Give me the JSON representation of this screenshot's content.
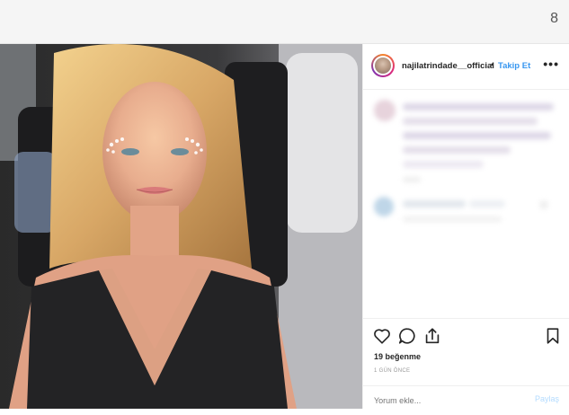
{
  "page": {
    "number": "8"
  },
  "post": {
    "username": "najilatrindade__official",
    "separator": "•",
    "follow_label": "Takip Et",
    "more_label": "•••",
    "likes": "19 beğenme",
    "time": "1 GÜN ÖNCE",
    "comment_placeholder": "Yorum ekle...",
    "post_label": "Paylaş"
  },
  "colors": {
    "accent": "#3897f0",
    "text": "#262626",
    "muted": "#999999",
    "disabled_accent": "#b3dbff"
  },
  "icons": [
    "heart-icon",
    "comment-icon",
    "share-icon",
    "bookmark-icon"
  ]
}
